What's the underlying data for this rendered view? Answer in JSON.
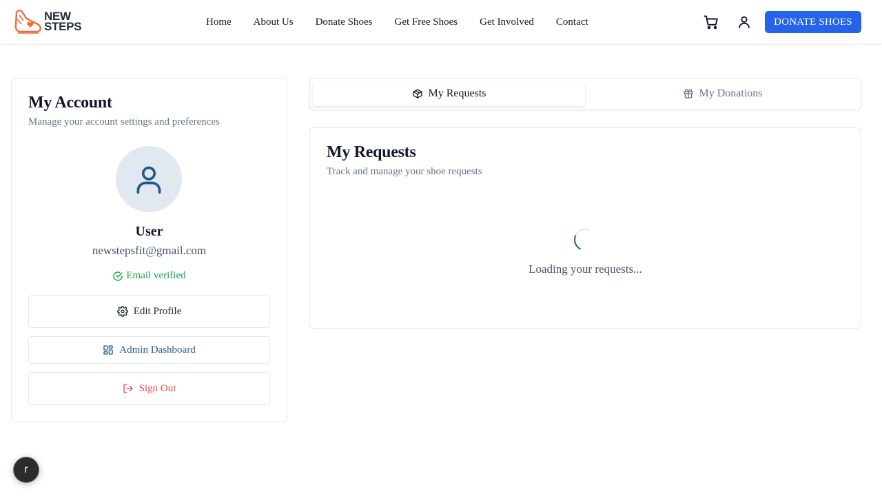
{
  "brand": {
    "name_line1": "NEW",
    "name_line2": "STEPS",
    "accent_color": "#f26b3a",
    "ink_color": "#1e293b"
  },
  "nav": {
    "items": [
      {
        "label": "Home"
      },
      {
        "label": "About Us"
      },
      {
        "label": "Donate Shoes"
      },
      {
        "label": "Get Free Shoes"
      },
      {
        "label": "Get Involved"
      },
      {
        "label": "Contact"
      }
    ],
    "cart_icon": "shopping-cart-icon",
    "user_icon": "user-icon",
    "cta_label": "DONATE SHOES",
    "cta_color": "#2563eb"
  },
  "account": {
    "title": "My Account",
    "subtitle": "Manage your account settings and preferences",
    "avatar_icon": "user-icon",
    "user_name": "User",
    "email": "newstepsfit@gmail.com",
    "verified_label": "Email verified",
    "verified_color": "#16a34a",
    "buttons": {
      "edit_profile": "Edit Profile",
      "admin_dashboard": "Admin Dashboard",
      "sign_out": "Sign Out"
    }
  },
  "tabs": [
    {
      "label": "My Requests",
      "icon": "package-icon",
      "active": true
    },
    {
      "label": "My Donations",
      "icon": "gift-icon",
      "active": false
    }
  ],
  "requests": {
    "title": "My Requests",
    "subtitle": "Track and manage your shoe requests",
    "loading_text": "Loading your requests..."
  },
  "floating_button": {
    "label": "r"
  }
}
